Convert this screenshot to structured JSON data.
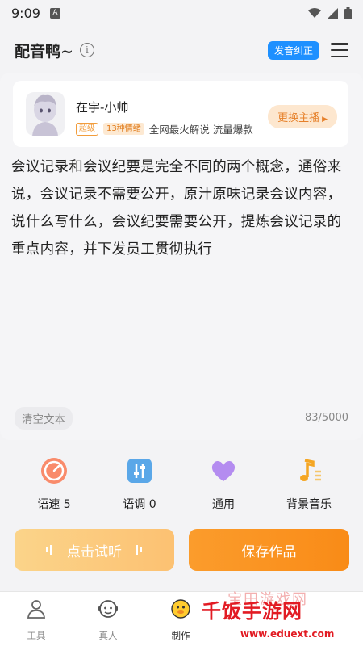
{
  "status_bar": {
    "time": "9:09",
    "a_badge": "A"
  },
  "header": {
    "title": "配音鸭~",
    "info_symbol": "i",
    "pronunciation_label": "发音纠正"
  },
  "voice": {
    "name": "在宇-小帅",
    "tag_level": "超级",
    "tag_emotions": "13种情绪",
    "description": "全网最火解说 流量爆款",
    "switch_label": "更换主播"
  },
  "editor": {
    "text": "会议记录和会议纪要是完全不同的两个概念，通俗来说，会议记录不需要公开，原汁原味记录会议内容，说什么写什么，会议纪要需要公开，提炼会议记录的重点内容，并下发员工贯彻执行",
    "clear_label": "清空文本",
    "counter": "83/5000"
  },
  "tools": [
    {
      "label": "语速 5",
      "icon": "speedometer-icon"
    },
    {
      "label": "语调 0",
      "icon": "sliders-icon"
    },
    {
      "label": "通用",
      "icon": "heart-icon"
    },
    {
      "label": "背景音乐",
      "icon": "music-note-icon"
    }
  ],
  "actions": {
    "listen_label": "点击试听",
    "save_label": "保存作品"
  },
  "tabs": [
    {
      "label": "工具",
      "icon": "tools-person-icon"
    },
    {
      "label": "真人",
      "icon": "headset-face-icon"
    },
    {
      "label": "制作",
      "icon": "duck-face-icon",
      "active": true
    }
  ],
  "watermark": {
    "cn": "千饭手游网",
    "url": "www.eduext.com",
    "bg_text": "宝田游戏网"
  },
  "colors": {
    "accent_orange": "#f98b17",
    "badge_blue": "#1e90ff",
    "light_orange": "#fcc172"
  }
}
